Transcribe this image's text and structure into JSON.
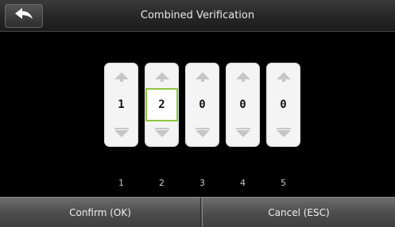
{
  "header": {
    "title": "Combined Verification",
    "back_icon": "back-arrow-icon"
  },
  "digits": [
    {
      "value": "1",
      "index": "1",
      "selected": false
    },
    {
      "value": "2",
      "index": "2",
      "selected": true
    },
    {
      "value": "0",
      "index": "3",
      "selected": false
    },
    {
      "value": "0",
      "index": "4",
      "selected": false
    },
    {
      "value": "0",
      "index": "5",
      "selected": false
    }
  ],
  "footer": {
    "confirm_label": "Confirm (OK)",
    "cancel_label": "Cancel (ESC)"
  },
  "colors": {
    "selection_border": "#8ec63f",
    "background": "#000000"
  }
}
